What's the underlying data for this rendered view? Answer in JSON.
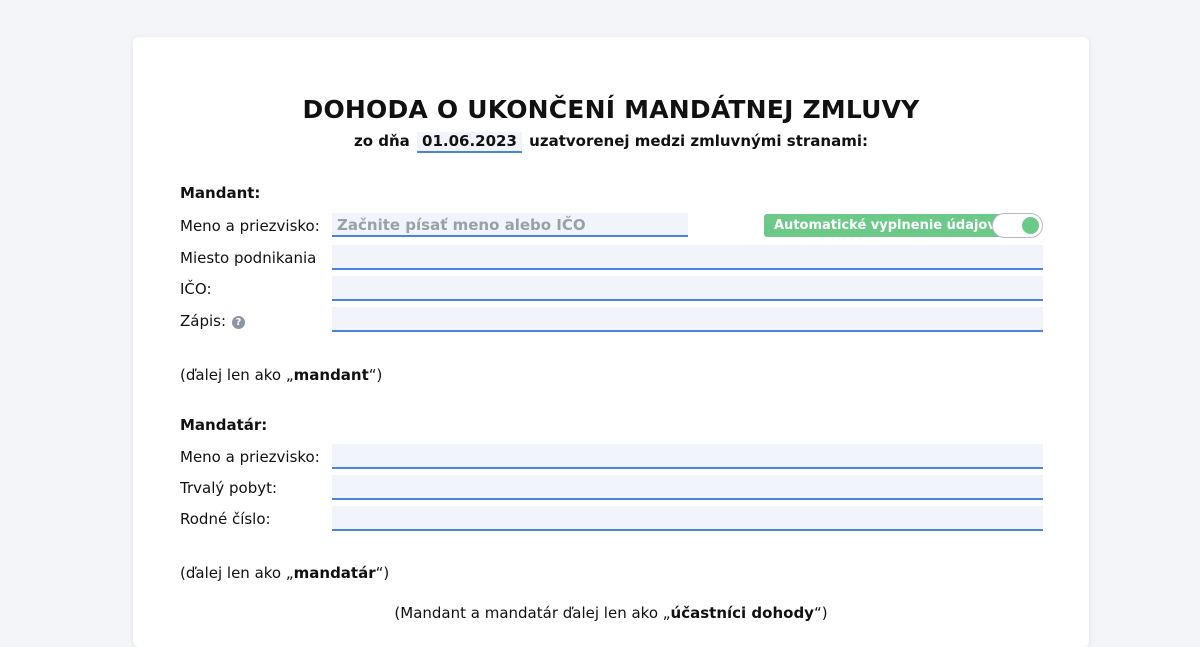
{
  "document": {
    "title": "DOHODA O UKONČENÍ MANDÁTNEJ ZMLUVY",
    "subtitle_prefix": "zo dňa",
    "date": "01.06.2023",
    "subtitle_suffix": "uzatvorenej medzi zmluvnými stranami:"
  },
  "mandant": {
    "heading": "Mandant:",
    "name_label": "Meno a priezvisko:",
    "name_placeholder": "Začnite písať meno alebo IČO",
    "autofill_label": "Automatické vyplnenie údajov",
    "autofill_enabled": true,
    "business_place_label": "Miesto podnikania",
    "ico_label": "IČO:",
    "register_label": "Zápis:",
    "note_prefix": "(ďalej len ako „",
    "note_term": "mandant",
    "note_suffix": "“)"
  },
  "mandatar": {
    "heading": "Mandatár:",
    "name_label": "Meno a priezvisko:",
    "residence_label": "Trvalý pobyt:",
    "birth_number_label": "Rodné číslo:",
    "note_prefix": "(ďalej len ako „",
    "note_term": "mandatár",
    "note_suffix": "“)"
  },
  "parties_note": {
    "prefix": "(Mandant a mandatár ďalej len ako „",
    "term": "účastníci dohody",
    "suffix": "“)"
  },
  "colors": {
    "field_underline": "#4a82dc",
    "field_background": "#f1f4fb",
    "accent_green": "#6cc98a"
  }
}
